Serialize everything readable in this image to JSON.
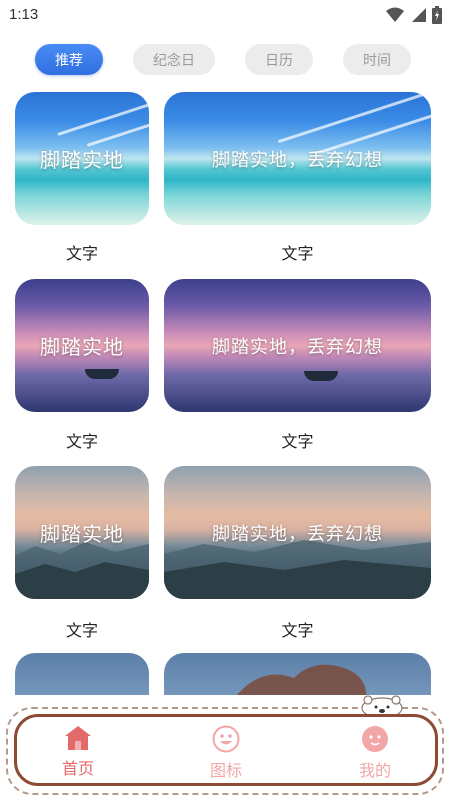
{
  "status_bar": {
    "time": "1:13",
    "icons": [
      "wifi-icon",
      "signal-icon",
      "battery-icon"
    ]
  },
  "tabs": [
    {
      "label": "推荐",
      "active": true
    },
    {
      "label": "纪念日",
      "active": false
    },
    {
      "label": "日历",
      "active": false
    },
    {
      "label": "时间",
      "active": false
    }
  ],
  "cards": [
    {
      "small_text": "脚踏实地",
      "wide_text": "脚踏实地，丢弃幻想",
      "small_caption": "文字",
      "wide_caption": "文字"
    },
    {
      "small_text": "脚踏实地",
      "wide_text": "脚踏实地，丢弃幻想",
      "small_caption": "文字",
      "wide_caption": "文字"
    },
    {
      "small_text": "脚踏实地",
      "wide_text": "脚踏实地，丢弃幻想",
      "small_caption": "文字",
      "wide_caption": "文字"
    }
  ],
  "bottom_nav": [
    {
      "label": "首页",
      "icon": "home-icon",
      "active": true
    },
    {
      "label": "图标",
      "icon": "smiley-icon",
      "active": false
    },
    {
      "label": "我的",
      "icon": "profile-face-icon",
      "active": false
    }
  ],
  "colors": {
    "accent": "#2f6fe0",
    "nav_active": "#e36a6a",
    "nav_inactive": "#f2a6a6",
    "nav_border": "#8d4b33"
  }
}
